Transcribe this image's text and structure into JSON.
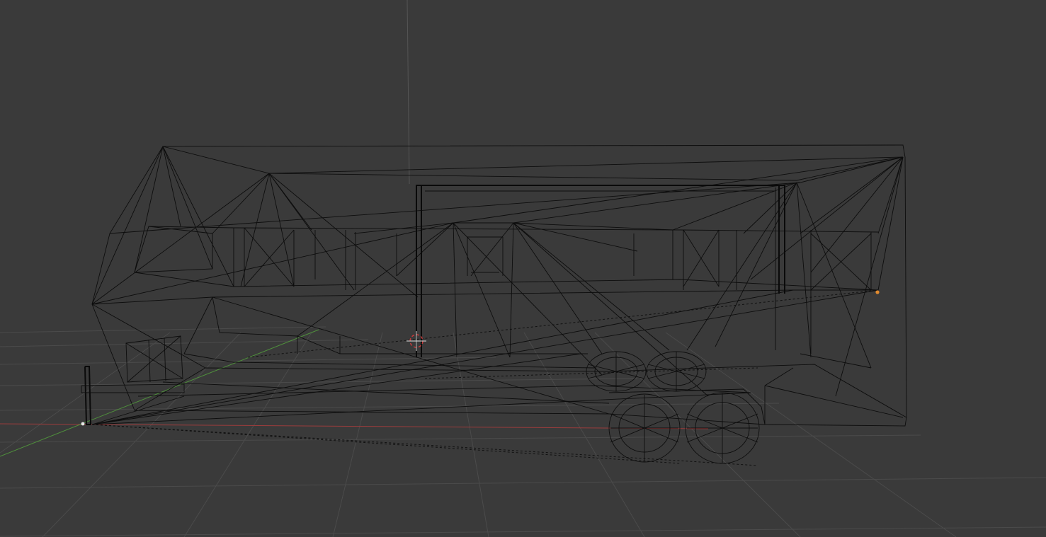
{
  "viewport": {
    "background_color": "#3a3a3a",
    "grid_color": "#4b4b4b",
    "x_axis_color": "#9b3c3c",
    "y_axis_color": "#4f8f3c",
    "z_axis_color": "#5a5a5a",
    "wire_color": "#0d0d0d",
    "origin_point_color": "#e08a2e",
    "vertex_point_color": "#e6e6e6",
    "cursor_color": "#d03a3a"
  },
  "object": {
    "type": "wireframe-mesh",
    "description_icon": "trailer-mesh-icon"
  }
}
